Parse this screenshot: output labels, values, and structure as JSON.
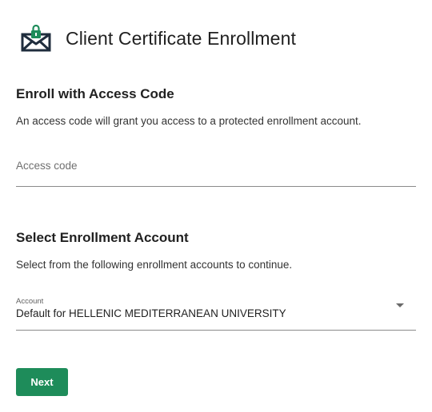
{
  "header": {
    "title": "Client Certificate Enrollment",
    "logo_icon": "envelope-lock-icon",
    "brand_color": "#1e8c5a"
  },
  "access_code_section": {
    "title": "Enroll with Access Code",
    "description": "An access code will grant you access to a protected enrollment account.",
    "input_placeholder": "Access code",
    "input_value": ""
  },
  "account_section": {
    "title": "Select Enrollment Account",
    "description": "Select from the following enrollment accounts to continue.",
    "select_label": "Account",
    "select_value": "Default for HELLENIC MEDITERRANEAN UNIVERSITY",
    "dropdown_icon": "caret-down-icon"
  },
  "actions": {
    "next_label": "Next"
  }
}
